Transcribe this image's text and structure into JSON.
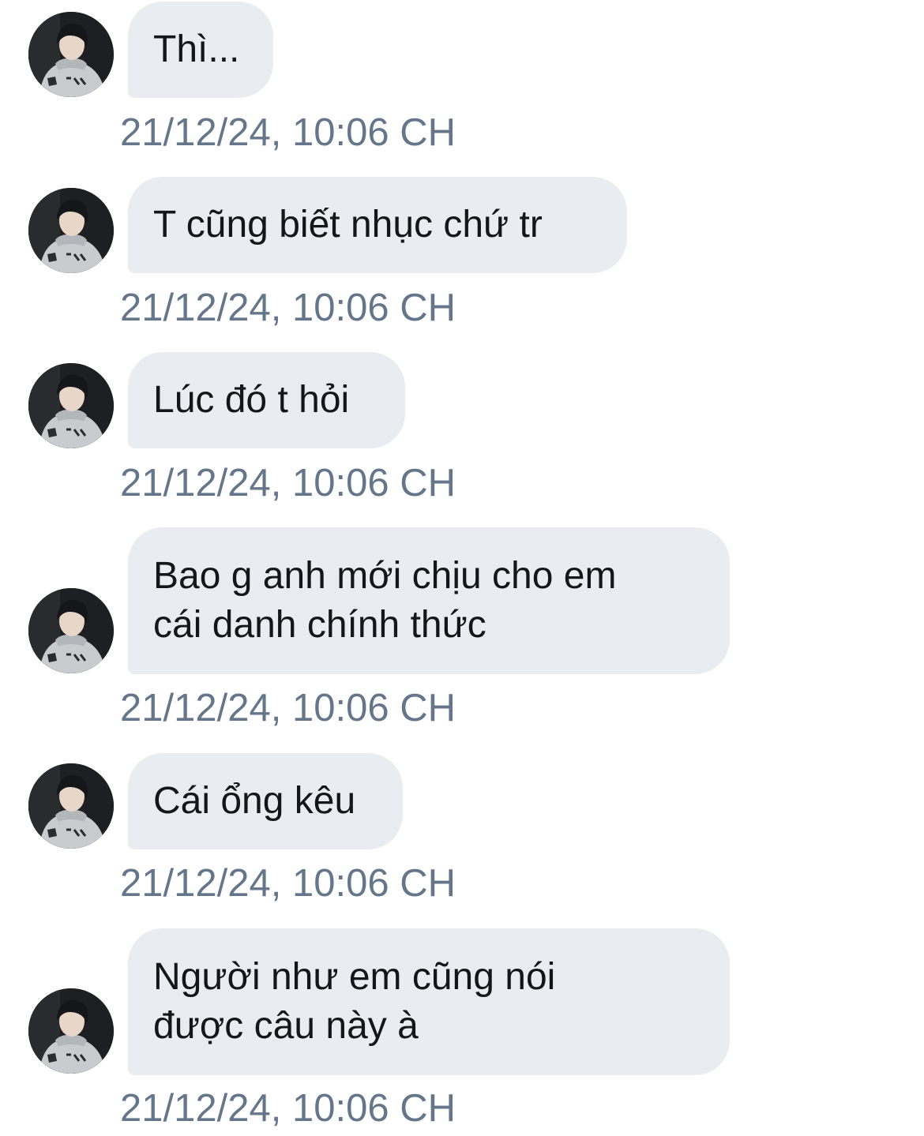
{
  "messages": [
    {
      "text": "Thì...",
      "timestamp": "21/12/24, 10:06 CH"
    },
    {
      "text": "T cũng biết nhục chứ tr",
      "timestamp": "21/12/24, 10:06 CH"
    },
    {
      "text": "Lúc đó t hỏi",
      "timestamp": "21/12/24, 10:06 CH"
    },
    {
      "text": "Bao g anh mới chịu cho em\ncái danh chính thức",
      "timestamp": "21/12/24, 10:06 CH"
    },
    {
      "text": "Cái ổng kêu",
      "timestamp": "21/12/24, 10:06 CH"
    },
    {
      "text": "Người như em cũng nói\nđược câu này à",
      "timestamp": "21/12/24, 10:06 CH"
    }
  ],
  "colors": {
    "bubble": "#e9edf1",
    "message_text": "#14171a",
    "timestamp": "#66768a",
    "background": "#ffffff"
  },
  "icons": {
    "avatar": "profile-photo"
  }
}
